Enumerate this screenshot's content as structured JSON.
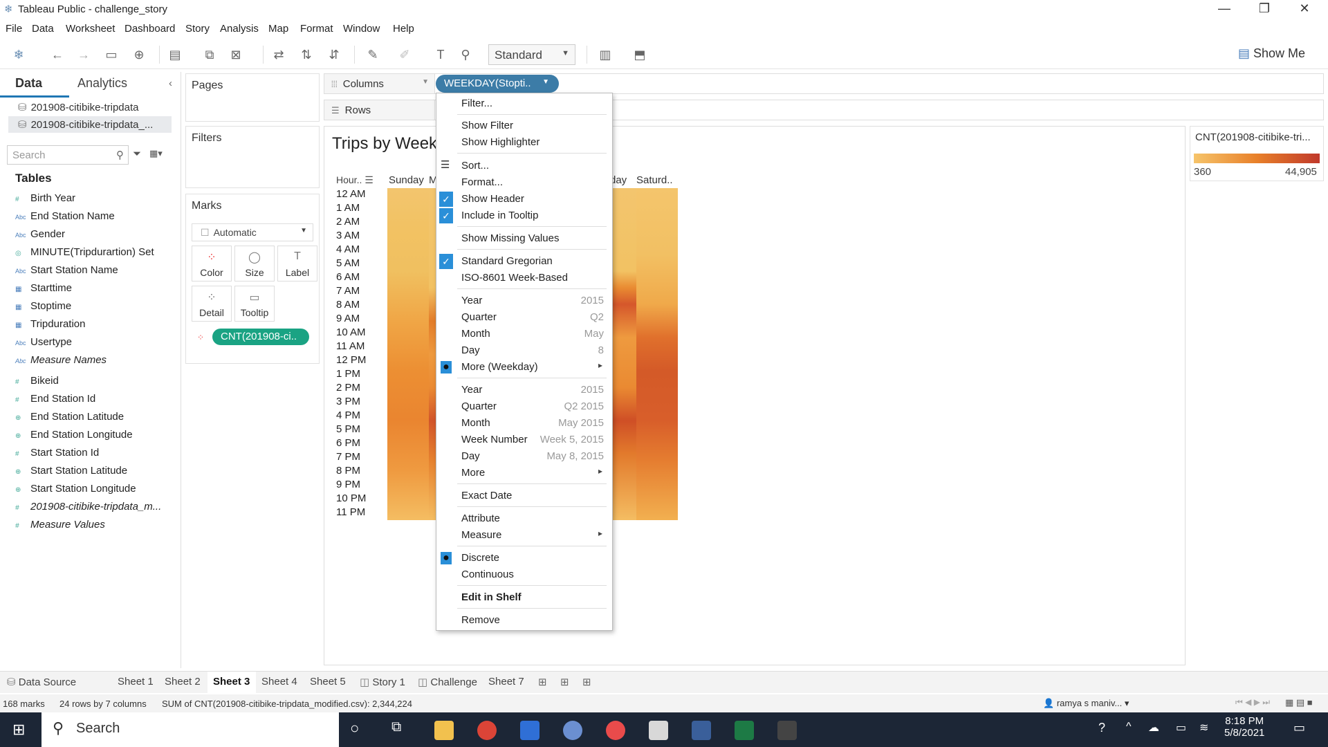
{
  "window": {
    "title": "Tableau Public - challenge_story",
    "minimize": "—",
    "restore": "❐",
    "close": "✕"
  },
  "menu": [
    "File",
    "Data",
    "Worksheet",
    "Dashboard",
    "Story",
    "Analysis",
    "Map",
    "Format",
    "Window",
    "Help"
  ],
  "toolbar": {
    "fit_select": "Standard",
    "show_me": "Show Me"
  },
  "data_pane": {
    "tabs": {
      "data": "Data",
      "analytics": "Analytics"
    },
    "sources": [
      "201908-citibike-tripdata",
      "201908-citibike-tripdata_..."
    ],
    "search_placeholder": "Search",
    "tables_heading": "Tables",
    "fields": [
      {
        "type": "#",
        "name": "Birth Year"
      },
      {
        "type": "Abc",
        "name": "End Station Name"
      },
      {
        "type": "Abc",
        "name": "Gender"
      },
      {
        "type": "set",
        "name": "MINUTE(Tripdurartion) Set"
      },
      {
        "type": "Abc",
        "name": "Start Station Name"
      },
      {
        "type": "date",
        "name": "Starttime"
      },
      {
        "type": "date",
        "name": "Stoptime"
      },
      {
        "type": "date",
        "name": "Tripduration"
      },
      {
        "type": "Abc",
        "name": "Usertype"
      },
      {
        "type": "Abc",
        "name": "Measure Names"
      },
      {
        "type": "#",
        "name": "Bikeid"
      },
      {
        "type": "#",
        "name": "End Station Id"
      },
      {
        "type": "geo",
        "name": "End Station Latitude"
      },
      {
        "type": "geo",
        "name": "End Station Longitude"
      },
      {
        "type": "#",
        "name": "Start Station Id"
      },
      {
        "type": "geo",
        "name": "Start Station Latitude"
      },
      {
        "type": "geo",
        "name": "Start Station Longitude"
      },
      {
        "type": "#",
        "name": "201908-citibike-tripdata_m..."
      },
      {
        "type": "#",
        "name": "Measure Values"
      }
    ]
  },
  "cards": {
    "pages": "Pages",
    "filters": "Filters",
    "marks": "Marks",
    "mark_type": "Automatic",
    "mark_buttons": [
      "Color",
      "Size",
      "Label",
      "Detail",
      "Tooltip"
    ],
    "cnt_pill": "CNT(201908-ci.."
  },
  "shelves": {
    "columns": "Columns",
    "rows": "Rows",
    "weekday_pill": "WEEKDAY(Stopti.."
  },
  "view": {
    "title": "Trips by Week",
    "hour_header": "Hour..",
    "weekday_headers": [
      "Sunday",
      "M",
      "day",
      "Saturd.."
    ],
    "hours": [
      "12 AM",
      "1 AM",
      "2 AM",
      "3 AM",
      "4 AM",
      "5 AM",
      "6 AM",
      "7 AM",
      "8 AM",
      "9 AM",
      "10 AM",
      "11 AM",
      "12 PM",
      "1 PM",
      "2 PM",
      "3 PM",
      "4 PM",
      "5 PM",
      "6 PM",
      "7 PM",
      "8 PM",
      "9 PM",
      "10 PM",
      "11 PM"
    ]
  },
  "legend": {
    "title": "CNT(201908-citibike-tri...",
    "min": "360",
    "max": "44,905"
  },
  "context_menu": {
    "filter": "Filter...",
    "show_filter": "Show Filter",
    "show_highlighter": "Show Highlighter",
    "sort": "Sort...",
    "format": "Format...",
    "show_header": "Show Header",
    "include_tooltip": "Include in Tooltip",
    "show_missing": "Show Missing Values",
    "std_gregorian": "Standard Gregorian",
    "iso": "ISO-8601 Week-Based",
    "d1": [
      {
        "l": "Year",
        "v": "2015"
      },
      {
        "l": "Quarter",
        "v": "Q2"
      },
      {
        "l": "Month",
        "v": "May"
      },
      {
        "l": "Day",
        "v": "8"
      }
    ],
    "more_weekday": "More (Weekday)",
    "d2": [
      {
        "l": "Year",
        "v": "2015"
      },
      {
        "l": "Quarter",
        "v": "Q2 2015"
      },
      {
        "l": "Month",
        "v": "May 2015"
      },
      {
        "l": "Week Number",
        "v": "Week 5, 2015"
      },
      {
        "l": "Day",
        "v": "May 8, 2015"
      }
    ],
    "more": "More",
    "exact_date": "Exact Date",
    "attribute": "Attribute",
    "measure": "Measure",
    "discrete": "Discrete",
    "continuous": "Continuous",
    "edit_in_shelf": "Edit in Shelf",
    "remove": "Remove"
  },
  "sheet_tabs": [
    "Data Source",
    "Sheet 1",
    "Sheet 2",
    "Sheet 3",
    "Sheet 4",
    "Sheet 5",
    "Story 1",
    "Challenge",
    "Sheet 7"
  ],
  "status": {
    "marks": "168 marks",
    "dims": "24 rows by 7 columns",
    "sum": "SUM of CNT(201908-citibike-tripdata_modified.csv): 2,344,224",
    "user": "ramya s maniv..."
  },
  "taskbar": {
    "search": "Search",
    "time": "8:18 PM",
    "date": "5/8/2021"
  }
}
